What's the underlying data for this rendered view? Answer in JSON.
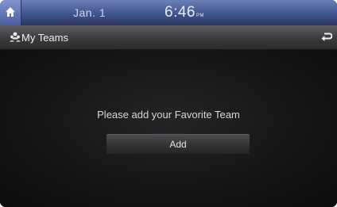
{
  "status_bar": {
    "home_icon": "home-icon",
    "date": "Jan. 1",
    "time": "6:46",
    "ampm": "PM"
  },
  "title_bar": {
    "icon": "team-people-icon",
    "title": "My Teams",
    "back_icon": "back-arrow-icon"
  },
  "main": {
    "message": "Please add your Favorite Team",
    "add_button_label": "Add"
  },
  "colors": {
    "status_bar_blue": "#4a5d9e",
    "title_bar_gray": "#3b3b3e",
    "background": "#0b0b0c"
  }
}
